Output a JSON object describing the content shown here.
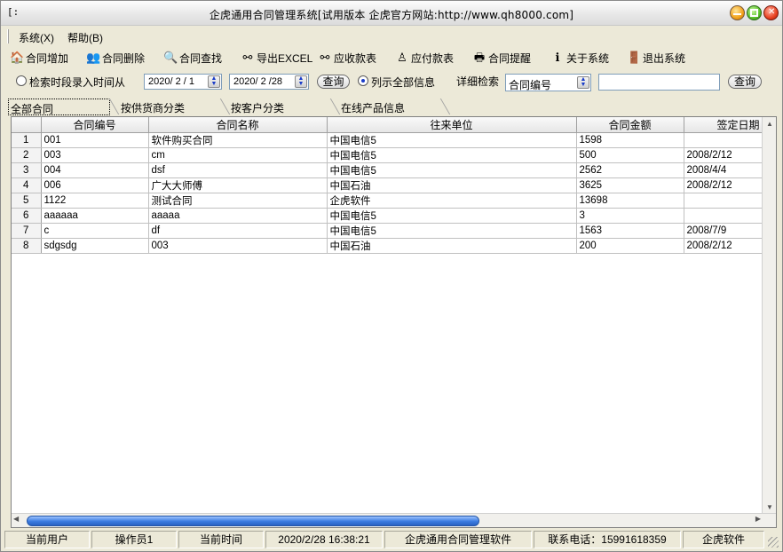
{
  "window": {
    "title": "企虎通用合同管理系统[试用版本 企虎官方网站:http://www.qh8000.com]",
    "app_icon": "app-icon"
  },
  "menubar": [
    {
      "label": "系统(X)"
    },
    {
      "label": "帮助(B)"
    }
  ],
  "toolbar": [
    {
      "label": "合同增加",
      "icon": "house-icon"
    },
    {
      "label": "合同删除",
      "icon": "users-icon"
    },
    {
      "label": "合同查找",
      "icon": "person-search-icon"
    },
    {
      "label": "导出EXCEL",
      "icon": "binoculars-icon"
    },
    {
      "label": "应收款表",
      "icon": "binoculars-icon"
    },
    {
      "label": "应付款表",
      "icon": "person-icon"
    },
    {
      "label": "合同提醒",
      "icon": "printer-icon"
    },
    {
      "label": "关于系统",
      "icon": "info-icon"
    },
    {
      "label": "退出系统",
      "icon": "exit-door-icon"
    }
  ],
  "filter": {
    "by_time_label": "检索时段录入时间从",
    "date_from": "2020/ 2 / 1",
    "date_to": "2020/ 2 /28",
    "query_label": "查询",
    "list_all_label": "列示全部信息",
    "detail_search_label": "详细检索",
    "detail_field": "合同编号",
    "detail_value": "",
    "query2_label": "查询"
  },
  "tabs": [
    {
      "label": "全部合同",
      "active": true
    },
    {
      "label": "按供货商分类",
      "active": false
    },
    {
      "label": "按客户分类",
      "active": false
    },
    {
      "label": "在线产品信息",
      "active": false
    }
  ],
  "table": {
    "columns": [
      "合同编号",
      "合同名称",
      "往来单位",
      "合同金额",
      "签定日期"
    ],
    "rows": [
      {
        "n": "1",
        "id": "001",
        "name": "软件购买合同",
        "unit": "中国电信5",
        "amount": "1598",
        "date": ""
      },
      {
        "n": "2",
        "id": "003",
        "name": "cm",
        "unit": "中国电信5",
        "amount": "500",
        "date": "2008/2/12"
      },
      {
        "n": "3",
        "id": "004",
        "name": "dsf",
        "unit": "中国电信5",
        "amount": "2562",
        "date": "2008/4/4"
      },
      {
        "n": "4",
        "id": "006",
        "name": "广大大师傅",
        "unit": "中国石油",
        "amount": "3625",
        "date": "2008/2/12"
      },
      {
        "n": "5",
        "id": "1122",
        "name": "测试合同",
        "unit": "企虎软件",
        "amount": "13698",
        "date": ""
      },
      {
        "n": "6",
        "id": "aaaaaa",
        "name": "aaaaa",
        "unit": "中国电信5",
        "amount": "3",
        "date": ""
      },
      {
        "n": "7",
        "id": "c",
        "name": "df",
        "unit": "中国电信5",
        "amount": "1563",
        "date": "2008/7/9"
      },
      {
        "n": "8",
        "id": "sdgsdg",
        "name": "003",
        "unit": "中国石油",
        "amount": "200",
        "date": "2008/2/12"
      }
    ]
  },
  "status": {
    "user_label": "当前用户",
    "user_value": "操作员1",
    "time_label": "当前时间",
    "time_value": "2020/2/28 16:38:21",
    "product": "企虎通用合同管理软件",
    "phone": "联系电话：15991618359",
    "company": "企虎软件"
  }
}
